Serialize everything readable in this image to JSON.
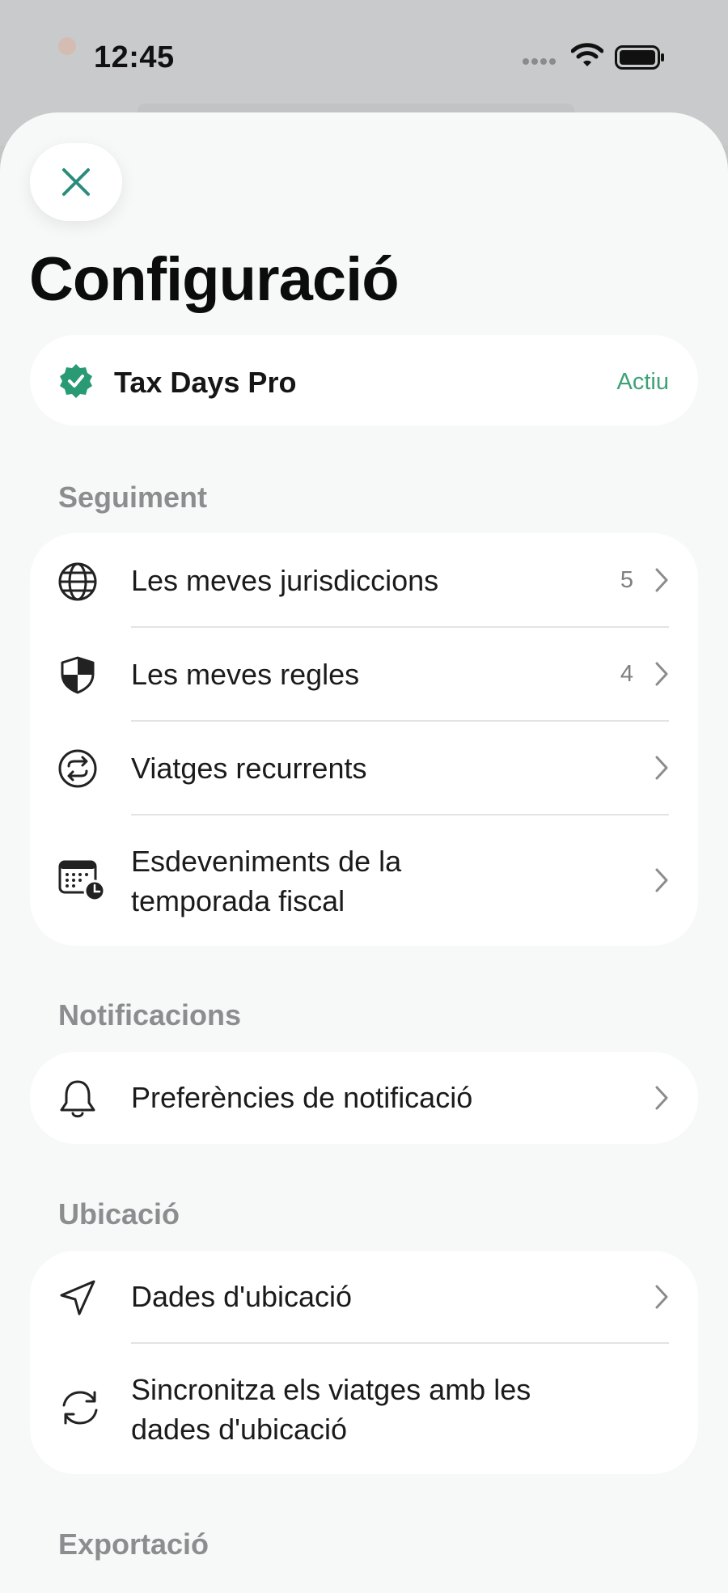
{
  "status_bar": {
    "time": "12:45"
  },
  "header": {
    "title": "Configuració"
  },
  "subscription": {
    "name": "Tax Days Pro",
    "status": "Actiu",
    "accent": "#2a9a75"
  },
  "sections": {
    "tracking": {
      "title": "Seguiment",
      "items": [
        {
          "label": "Les meves jurisdiccions",
          "count": "5",
          "icon": "globe-icon"
        },
        {
          "label": "Les meves regles",
          "count": "4",
          "icon": "shield-icon"
        },
        {
          "label": "Viatges recurrents",
          "icon": "repeat-icon"
        },
        {
          "label_line1": "Esdeveniments de la",
          "label_line2": "temporada fiscal",
          "icon": "calendar-clock-icon"
        }
      ]
    },
    "notifications": {
      "title": "Notificacions",
      "items": [
        {
          "label": "Preferències de notificació",
          "icon": "bell-icon"
        }
      ]
    },
    "location": {
      "title": "Ubicació",
      "items": [
        {
          "label": "Dades d'ubicació",
          "icon": "location-arrow-icon"
        },
        {
          "label_line1": "Sincronitza els viatges amb les",
          "label_line2": "dades d'ubicació",
          "icon": "sync-icon"
        }
      ]
    },
    "export": {
      "title": "Exportació"
    }
  }
}
